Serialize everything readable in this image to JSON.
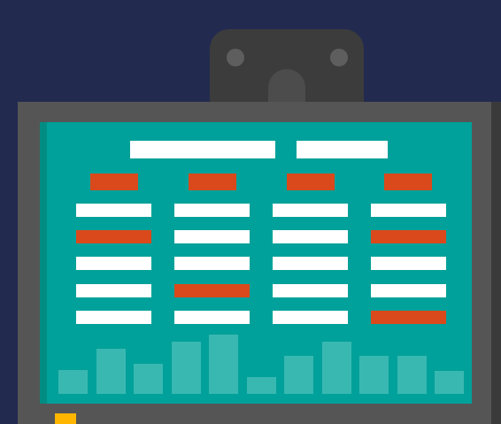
{
  "colors": {
    "background": "#222a4f",
    "device_frame": "#555555",
    "mount": "#3c3c3c",
    "screen": "#00a19a",
    "cell": "#ffffff",
    "alert": "#d9491b",
    "bar": "#39b8b2",
    "status_led": "#ffb600"
  },
  "table": {
    "columns": 4,
    "rows": [
      [
        "normal",
        "normal",
        "normal",
        "normal"
      ],
      [
        "alert",
        "normal",
        "normal",
        "alert"
      ],
      [
        "normal",
        "normal",
        "normal",
        "normal"
      ],
      [
        "normal",
        "alert",
        "normal",
        "normal"
      ],
      [
        "normal",
        "normal",
        "normal",
        "alert"
      ]
    ]
  },
  "bars": {
    "relative_heights": [
      0.4,
      0.76,
      0.51,
      0.88,
      1.0,
      0.28,
      0.64,
      0.88,
      0.64,
      0.64,
      0.39
    ]
  }
}
